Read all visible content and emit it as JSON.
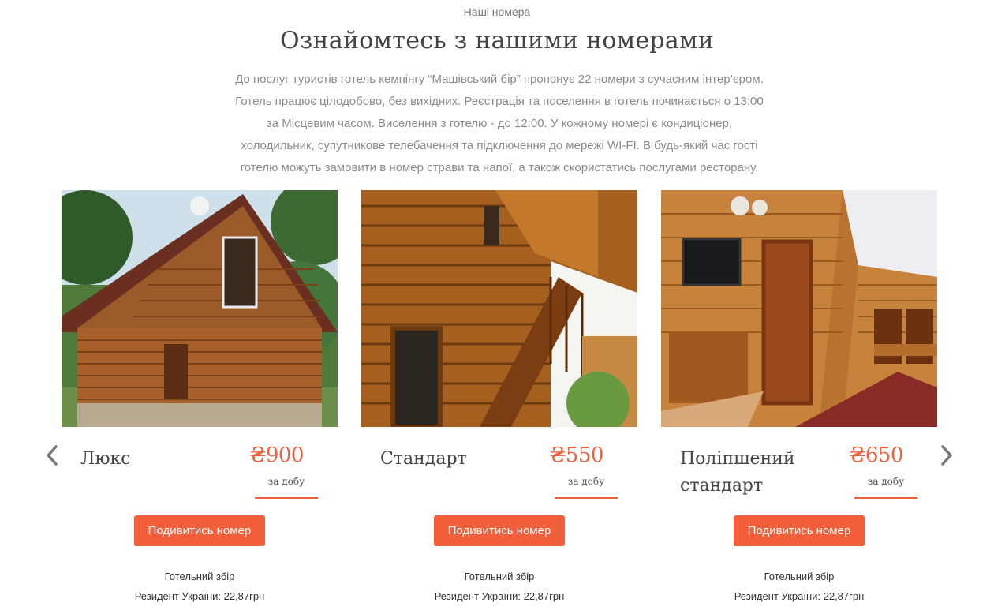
{
  "section": {
    "eyebrow": "Наші номера",
    "title": "Ознайомтесь з нашими номерами",
    "intro_lines": [
      "До послуг туристів готель кемпінгу “Машівський бір” пропонує 22 номери з сучасним інтер’єром.",
      "Готель працює цілодобово, без вихідних. Реєстрація та поселення в готель починається о 13:00",
      "за Місцевим часом. Виселення з готелю - до 12:00. У кожному номері є кондиціонер,",
      "холодильник, супутникове телебачення та підключення до мережі WI-FI. В будь-який час гості",
      "готелю можуть замовити в номер страви та напої, а також скористатись послугами ресторану."
    ]
  },
  "carousel": {
    "prev_icon": "chevron-left-icon",
    "next_icon": "chevron-right-icon",
    "rooms": [
      {
        "name": "Люкс",
        "price": "₴900",
        "per": "за добу",
        "button": "Подивитись номер",
        "tax_title": "Готельний збір",
        "tax_resident": "Резидент України: 22,87грн"
      },
      {
        "name": "Стандарт",
        "price": "₴550",
        "per": "за добу",
        "button": "Подивитись номер",
        "tax_title": "Готельний збір",
        "tax_resident": "Резидент України: 22,87грн"
      },
      {
        "name": "Поліпшений стандарт",
        "price": "₴650",
        "per": "за добу",
        "button": "Подивитись номер",
        "tax_title": "Готельний збір",
        "tax_resident": "Резидент України: 22,87грн"
      }
    ]
  },
  "colors": {
    "accent": "#f25f3a",
    "heading": "#444444",
    "muted": "#8a8a8a"
  }
}
